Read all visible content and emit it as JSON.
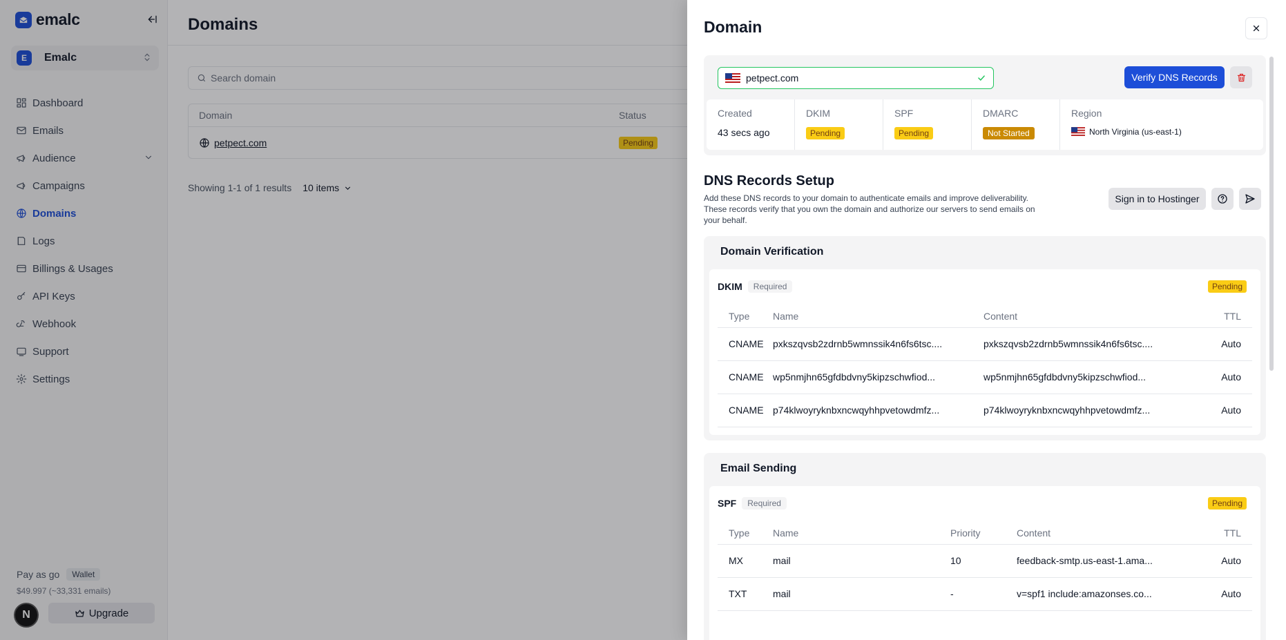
{
  "brand": {
    "name": "emalc"
  },
  "org": {
    "initial": "E",
    "name": "Emalc"
  },
  "nav": [
    {
      "label": "Dashboard",
      "icon": "dashboard-icon"
    },
    {
      "label": "Emails",
      "icon": "mail-icon"
    },
    {
      "label": "Audience",
      "icon": "megaphone-icon"
    },
    {
      "label": "Campaigns",
      "icon": "megaphone-icon"
    },
    {
      "label": "Domains",
      "icon": "globe-icon"
    },
    {
      "label": "Logs",
      "icon": "logs-icon"
    },
    {
      "label": "Billings & Usages",
      "icon": "credit-card-icon"
    },
    {
      "label": "API Keys",
      "icon": "key-icon"
    },
    {
      "label": "Webhook",
      "icon": "webhook-icon"
    },
    {
      "label": "Support",
      "icon": "support-icon"
    },
    {
      "label": "Settings",
      "icon": "gear-icon"
    }
  ],
  "plan": {
    "name": "Pay as go",
    "wallet": "Wallet",
    "balance": "$49.997 (~33,331 emails)",
    "avatar": "N",
    "upgrade": "Upgrade"
  },
  "main": {
    "title": "Domains",
    "search_placeholder": "Search domain",
    "columns": [
      "Domain",
      "Status"
    ],
    "rows": [
      {
        "domain": "petpect.com",
        "status": "Pending"
      }
    ],
    "results": "Showing 1-1 of 1 results",
    "per_page": "10 items"
  },
  "drawer": {
    "title": "Domain",
    "domain_value": "petpect.com",
    "verify_label": "Verify DNS Records",
    "meta": {
      "created_label": "Created",
      "created_value": "43 secs ago",
      "dkim_label": "DKIM",
      "dkim_value": "Pending",
      "spf_label": "SPF",
      "spf_value": "Pending",
      "dmarc_label": "DMARC",
      "dmarc_value": "Not Started",
      "region_label": "Region",
      "region_value": "North Virginia (us-east-1)"
    },
    "setup": {
      "title": "DNS Records Setup",
      "description": "Add these DNS records to your domain to authenticate emails and improve deliverability. These records verify that you own the domain and authorize our servers to send emails on your behalf.",
      "hostinger_label": "Sign in to Hostinger"
    },
    "verification": {
      "title": "Domain Verification",
      "record": "DKIM",
      "required": "Required",
      "status": "Pending",
      "columns": [
        "Type",
        "Name",
        "Content",
        "TTL"
      ],
      "rows": [
        [
          "CNAME",
          "pxkszqvsb2zdrnb5wmnssik4n6fs6tsc....",
          "pxkszqvsb2zdrnb5wmnssik4n6fs6tsc....",
          "Auto"
        ],
        [
          "CNAME",
          "wp5nmjhn65gfdbdvny5kipzschwfiod...",
          "wp5nmjhn65gfdbdvny5kipzschwfiod...",
          "Auto"
        ],
        [
          "CNAME",
          "p74klwoyryknbxncwqyhhpvetowdmfz...",
          "p74klwoyryknbxncwqyhhpvetowdmfz...",
          "Auto"
        ]
      ]
    },
    "sending": {
      "title": "Email Sending",
      "record": "SPF",
      "required": "Required",
      "status": "Pending",
      "columns": [
        "Type",
        "Name",
        "Priority",
        "Content",
        "TTL"
      ],
      "rows": [
        [
          "MX",
          "mail",
          "10",
          "feedback-smtp.us-east-1.ama...",
          "Auto"
        ],
        [
          "TXT",
          "mail",
          "-",
          "v=spf1 include:amazonses.co...",
          "Auto"
        ]
      ]
    }
  },
  "colors": {
    "accent": "#1d4ed8",
    "pending": "#facc15",
    "not_started": "#ca8a04",
    "success": "#22c55e"
  }
}
